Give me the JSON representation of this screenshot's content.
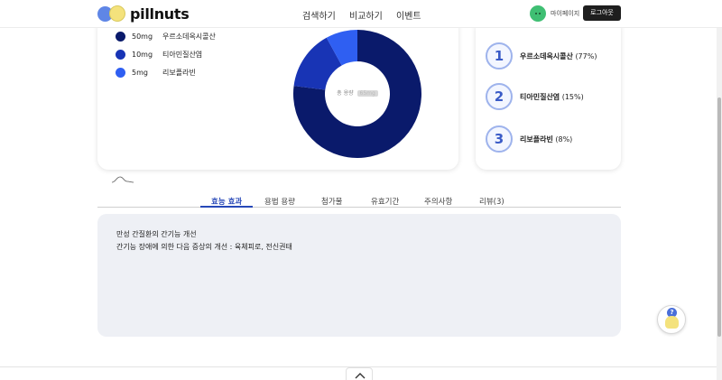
{
  "header": {
    "logo_text": "pillnuts",
    "nav": [
      "검색하기",
      "비교하기",
      "이벤트"
    ],
    "mypage_label": "마이페이지",
    "logout_label": "로그아웃"
  },
  "ingredients": [
    {
      "amount": "50mg",
      "name": "우르소데옥시콜산",
      "color": "#0a1a6b",
      "share": 77
    },
    {
      "amount": "10mg",
      "name": "티아민질산염",
      "color": "#1834b5",
      "share": 15
    },
    {
      "amount": "5mg",
      "name": "리보플라빈",
      "color": "#2f5ff2",
      "share": 8
    }
  ],
  "donut": {
    "center_label": "총 용량",
    "center_tag": "65mg"
  },
  "ranking": [
    {
      "rank": "1",
      "name": "우르소데옥시콜산",
      "pct": "(77%)"
    },
    {
      "rank": "2",
      "name": "티아민질산염",
      "pct": "(15%)"
    },
    {
      "rank": "3",
      "name": "리보플라빈",
      "pct": "(8%)"
    }
  ],
  "tabs": [
    "효능 효과",
    "용법 용량",
    "첨가물",
    "유효기간",
    "주의사항",
    "리뷰(3)"
  ],
  "active_tab": 0,
  "content": {
    "lines": [
      "만성 간질환의 간기능 개선",
      "간기능 장애에 의한 다음 증상의 개선 : 육체피로, 전신권태"
    ]
  },
  "colors": {
    "accent": "#2748b8",
    "panel": "#eef0f5"
  },
  "icons": {
    "scroll_top": "chevron-up-icon",
    "help": "help-mascot-icon"
  }
}
